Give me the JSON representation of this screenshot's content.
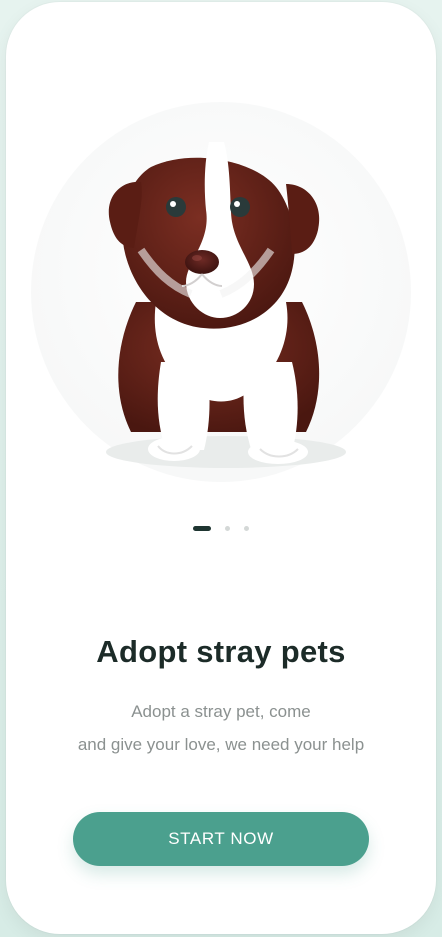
{
  "onboarding": {
    "title": "Adopt stray pets",
    "description_lines": [
      "Adopt a stray pet, come",
      "and give your love, we need your help"
    ],
    "cta_label": "START NOW",
    "pager": {
      "count": 3,
      "active_index": 0
    }
  },
  "colors": {
    "accent": "#4ba08e",
    "title": "#1c2b28",
    "subtitle": "#8b9190",
    "pager_active": "#1e3531",
    "pager_inactive": "#d4d8d7"
  },
  "hero": {
    "icon": "puppy-illustration"
  }
}
